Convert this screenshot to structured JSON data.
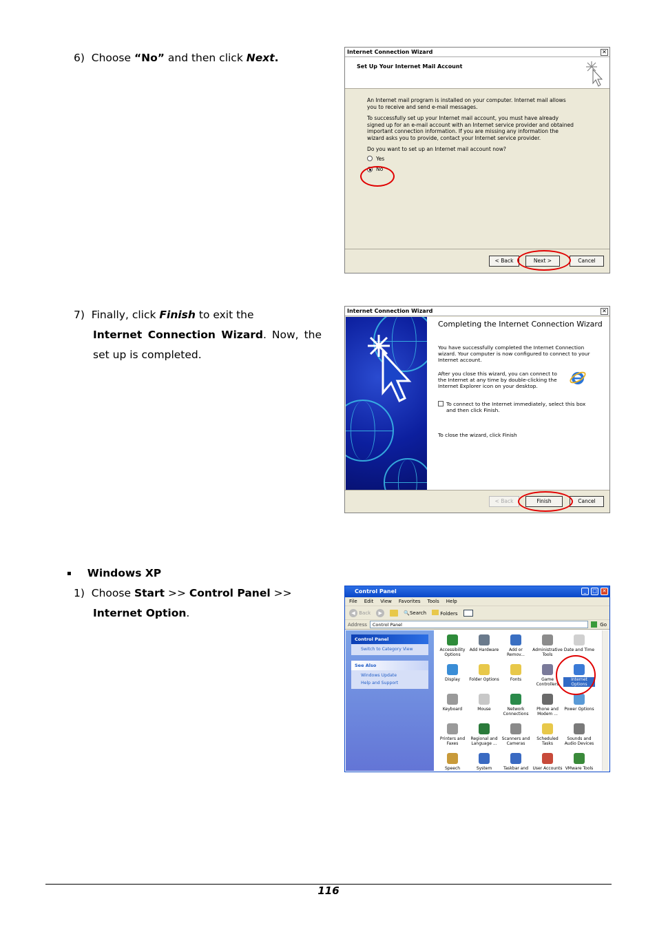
{
  "step6": {
    "num": "6)",
    "pre": "Choose",
    "choice": "“No”",
    "mid": "and then click",
    "action": "Next",
    "end": "."
  },
  "wizard1": {
    "title": "Internet Connection Wizard",
    "heading": "Set Up Your Internet Mail Account",
    "p1": "An Internet mail program is installed on your computer. Internet mail allows you to receive and send e-mail messages.",
    "p2": "To successfully set up your Internet mail account, you must have already signed up for an e-mail account with an Internet service provider and obtained important connection information. If you are missing any information the wizard asks you to provide, contact your Internet service provider.",
    "question": "Do you want to set up an Internet mail account now?",
    "yes": "Yes",
    "no": "No",
    "back": "< Back",
    "next": "Next >",
    "cancel": "Cancel"
  },
  "step7": {
    "num": "7)",
    "pre": "Finally, click",
    "action": "Finish",
    "mid": "to exit the",
    "wizard": "Internet Connection Wizard",
    "end": ". Now, the set up is completed."
  },
  "wizard2": {
    "title": "Internet Connection Wizard",
    "heading": "Completing the Internet Connection Wizard",
    "p1": "You have successfully completed the Internet Connection wizard. Your computer is now configured to connect to your Internet account.",
    "p2": "After you close this wizard, you can connect to the Internet at any time by double-clicking the Internet Explorer icon on your desktop.",
    "checkbox": "To connect to the Internet immediately, select this box and then click Finish.",
    "p3": "To close the wizard, click Finish",
    "back": "< Back",
    "finish": "Finish",
    "cancel": "Cancel"
  },
  "section": {
    "bullet": "▪",
    "title": "Windows XP"
  },
  "step1": {
    "num": "1)",
    "pre": "Choose",
    "start": "Start",
    "sep1": ">>",
    "cp": "Control Panel",
    "sep2": ">>",
    "io": "Internet Option",
    "end": "."
  },
  "control_panel": {
    "title": "Control Panel",
    "menu": [
      "File",
      "Edit",
      "View",
      "Favorites",
      "Tools",
      "Help"
    ],
    "toolbar": {
      "back": "Back",
      "search": "Search",
      "folders": "Folders"
    },
    "address_label": "Address",
    "address_value": "Control Panel",
    "go": "Go",
    "left_panel_title": "Control Panel",
    "switch_view": "Switch to Category View",
    "see_also": "See Also",
    "windows_update": "Windows Update",
    "help_support": "Help and Support",
    "items": [
      {
        "label": "Accessibility Options",
        "color": "#2e8b3a"
      },
      {
        "label": "Add Hardware",
        "color": "#6a7a8c"
      },
      {
        "label": "Add or Remov...",
        "color": "#3a6fc2"
      },
      {
        "label": "Administrative Tools",
        "color": "#8c8c8c"
      },
      {
        "label": "Date and Time",
        "color": "#d0d0d0"
      },
      {
        "label": "Display",
        "color": "#3a8dd6"
      },
      {
        "label": "Folder Options",
        "color": "#e8c84a"
      },
      {
        "label": "Fonts",
        "color": "#e8c84a"
      },
      {
        "label": "Game Controllers",
        "color": "#7a7a9a"
      },
      {
        "label": "Internet Options",
        "color": "#3a7ad6"
      },
      {
        "label": "Keyboard",
        "color": "#9a9a9a"
      },
      {
        "label": "Mouse",
        "color": "#c8c8c8"
      },
      {
        "label": "Network Connections",
        "color": "#2a8a4a"
      },
      {
        "label": "Phone and Modem ...",
        "color": "#6a6a6a"
      },
      {
        "label": "Power Options",
        "color": "#5a9ad6"
      },
      {
        "label": "Printers and Faxes",
        "color": "#9a9a9a"
      },
      {
        "label": "Regional and Language ...",
        "color": "#2a7a3a"
      },
      {
        "label": "Scanners and Cameras",
        "color": "#8a8a8a"
      },
      {
        "label": "Scheduled Tasks",
        "color": "#e8c84a"
      },
      {
        "label": "Sounds and Audio Devices",
        "color": "#7a7a7a"
      },
      {
        "label": "Speech",
        "color": "#c89a3a"
      },
      {
        "label": "System",
        "color": "#3a6ac2"
      },
      {
        "label": "Taskbar and",
        "color": "#3a6ac2"
      },
      {
        "label": "User Accounts",
        "color": "#c84a3a"
      },
      {
        "label": "VMware Tools",
        "color": "#3a8a3a"
      }
    ]
  },
  "page_number": "116"
}
